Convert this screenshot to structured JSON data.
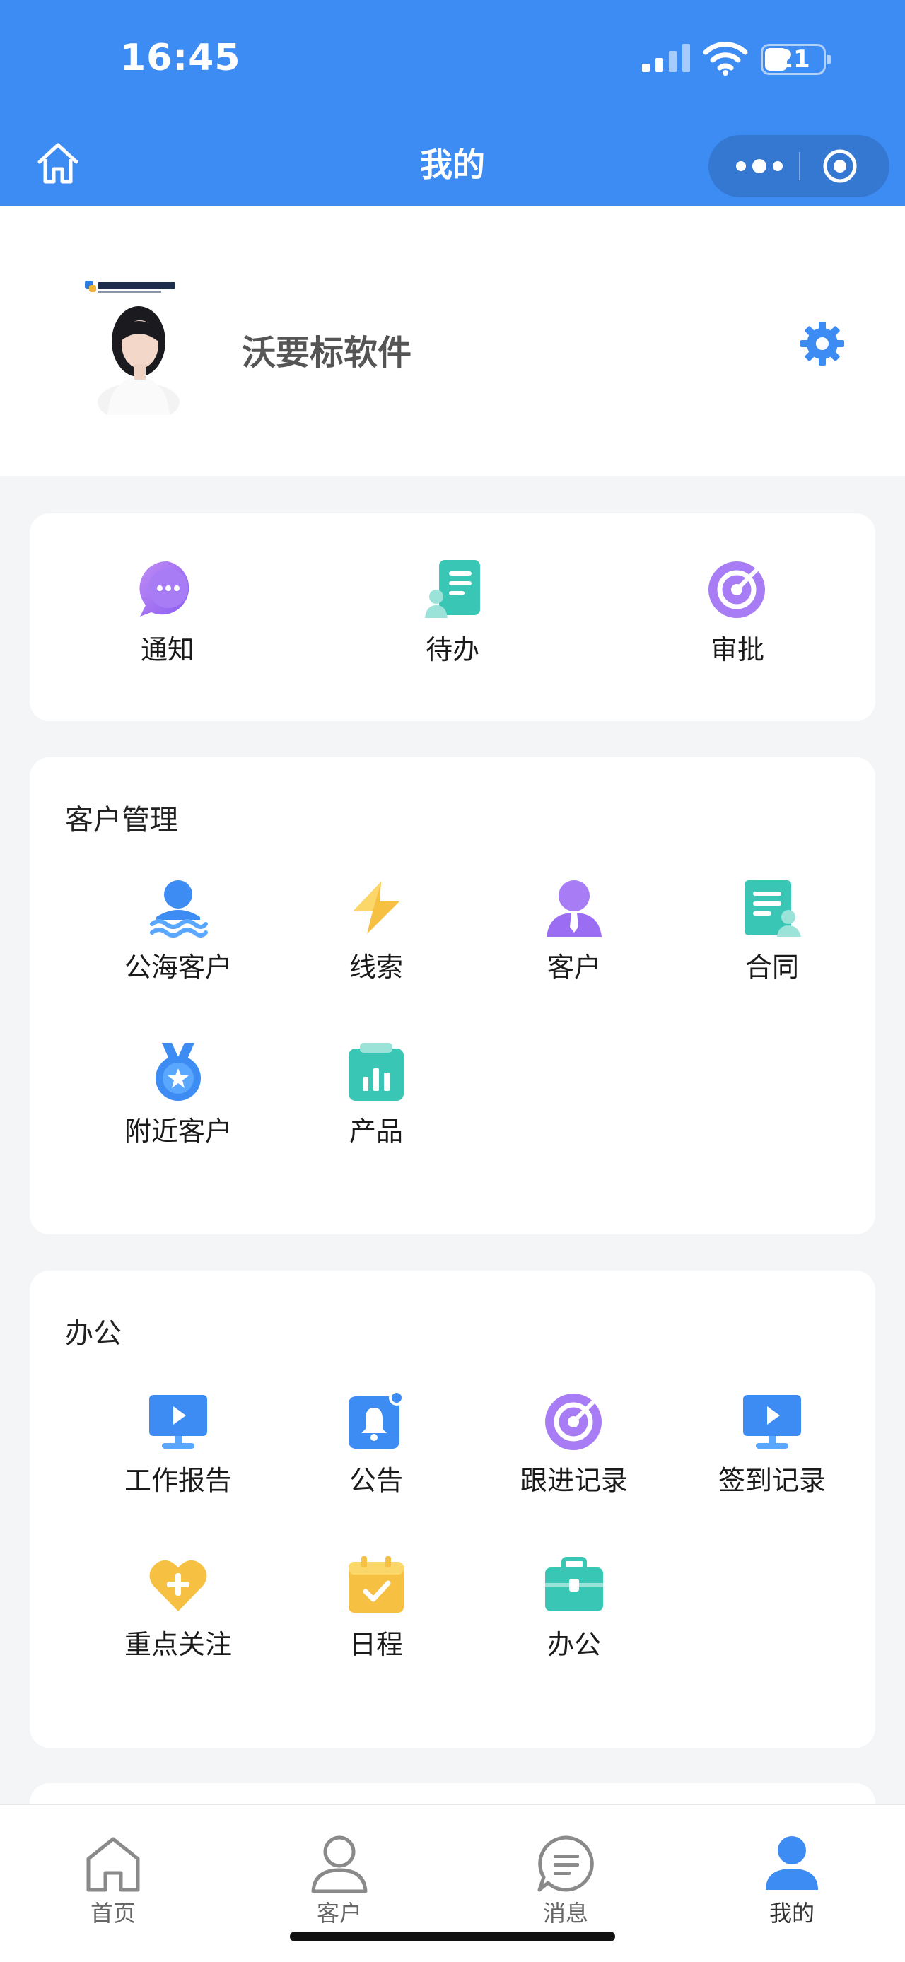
{
  "status_bar": {
    "time": "16:45",
    "battery": "21"
  },
  "nav": {
    "title": "我的"
  },
  "profile": {
    "name": "沃要标软件"
  },
  "quick": [
    {
      "label": "通知",
      "icon": "chat-bubble-icon"
    },
    {
      "label": "待办",
      "icon": "todo-list-icon"
    },
    {
      "label": "审批",
      "icon": "approval-target-icon"
    }
  ],
  "customer_section": {
    "title": "客户管理",
    "items": [
      {
        "label": "公海客户",
        "icon": "public-pool-icon"
      },
      {
        "label": "线索",
        "icon": "lightning-icon"
      },
      {
        "label": "客户",
        "icon": "customer-icon"
      },
      {
        "label": "合同",
        "icon": "contract-icon"
      },
      {
        "label": "附近客户",
        "icon": "nearby-medal-icon"
      },
      {
        "label": "产品",
        "icon": "product-chart-icon"
      }
    ]
  },
  "office_section": {
    "title": "办公",
    "items": [
      {
        "label": "工作报告",
        "icon": "monitor-icon"
      },
      {
        "label": "公告",
        "icon": "bell-icon"
      },
      {
        "label": "跟进记录",
        "icon": "target-icon"
      },
      {
        "label": "签到记录",
        "icon": "monitor-icon"
      },
      {
        "label": "重点关注",
        "icon": "heart-plus-icon"
      },
      {
        "label": "日程",
        "icon": "calendar-icon"
      },
      {
        "label": "办公",
        "icon": "briefcase-icon"
      }
    ]
  },
  "tabbar": [
    {
      "label": "首页",
      "icon": "home-tab-icon"
    },
    {
      "label": "客户",
      "icon": "customer-tab-icon"
    },
    {
      "label": "消息",
      "icon": "message-tab-icon"
    },
    {
      "label": "我的",
      "icon": "profile-tab-icon",
      "active": true
    }
  ],
  "colors": {
    "primary": "#3d8cf4",
    "page_bg": "#f4f5f7",
    "card_bg": "#ffffff"
  }
}
